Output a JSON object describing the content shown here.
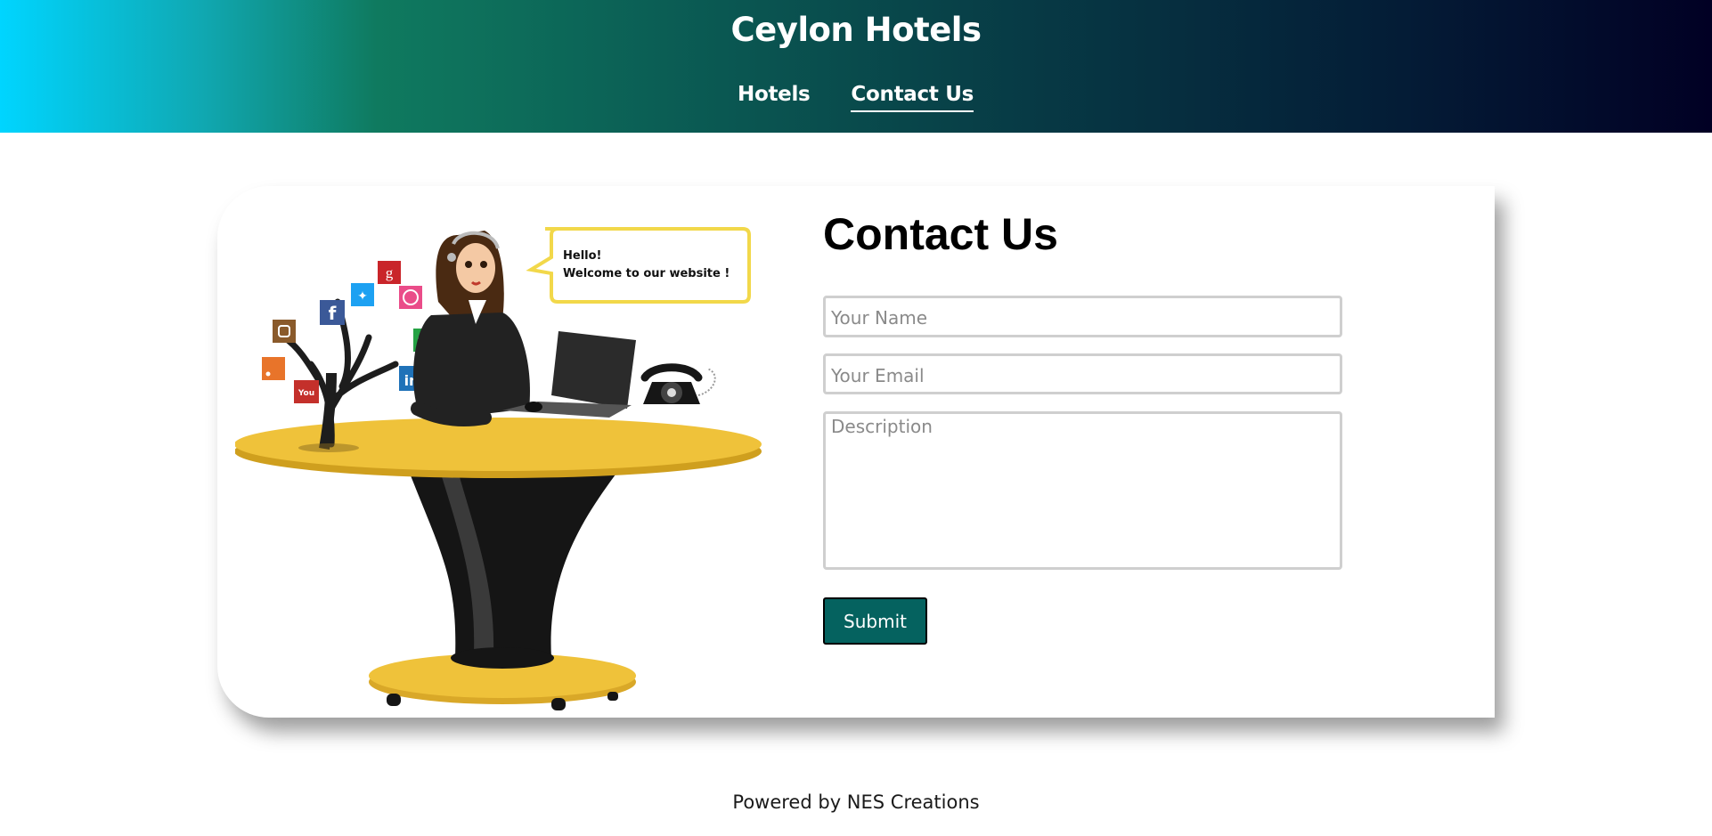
{
  "header": {
    "site_title": "Ceylon Hotels",
    "nav": [
      {
        "label": "Hotels",
        "active": false
      },
      {
        "label": "Contact Us",
        "active": true
      }
    ]
  },
  "illustration": {
    "speech_line1": "Hello!",
    "speech_line2": "Welcome to our website !",
    "social_icons": [
      "google-plus",
      "twitter",
      "dribbble",
      "facebook",
      "instagram",
      "whatsapp",
      "rss",
      "youtube",
      "linkedin"
    ]
  },
  "form": {
    "title": "Contact Us",
    "name_placeholder": "Your Name",
    "email_placeholder": "Your Email",
    "description_placeholder": "Description",
    "submit_label": "Submit"
  },
  "footer": {
    "text": "Powered by NES Creations"
  },
  "colors": {
    "header_gradient_start": "#00d5ff",
    "header_gradient_end": "#010024",
    "submit_bg": "#05625f",
    "field_border": "#cfcfcf"
  }
}
